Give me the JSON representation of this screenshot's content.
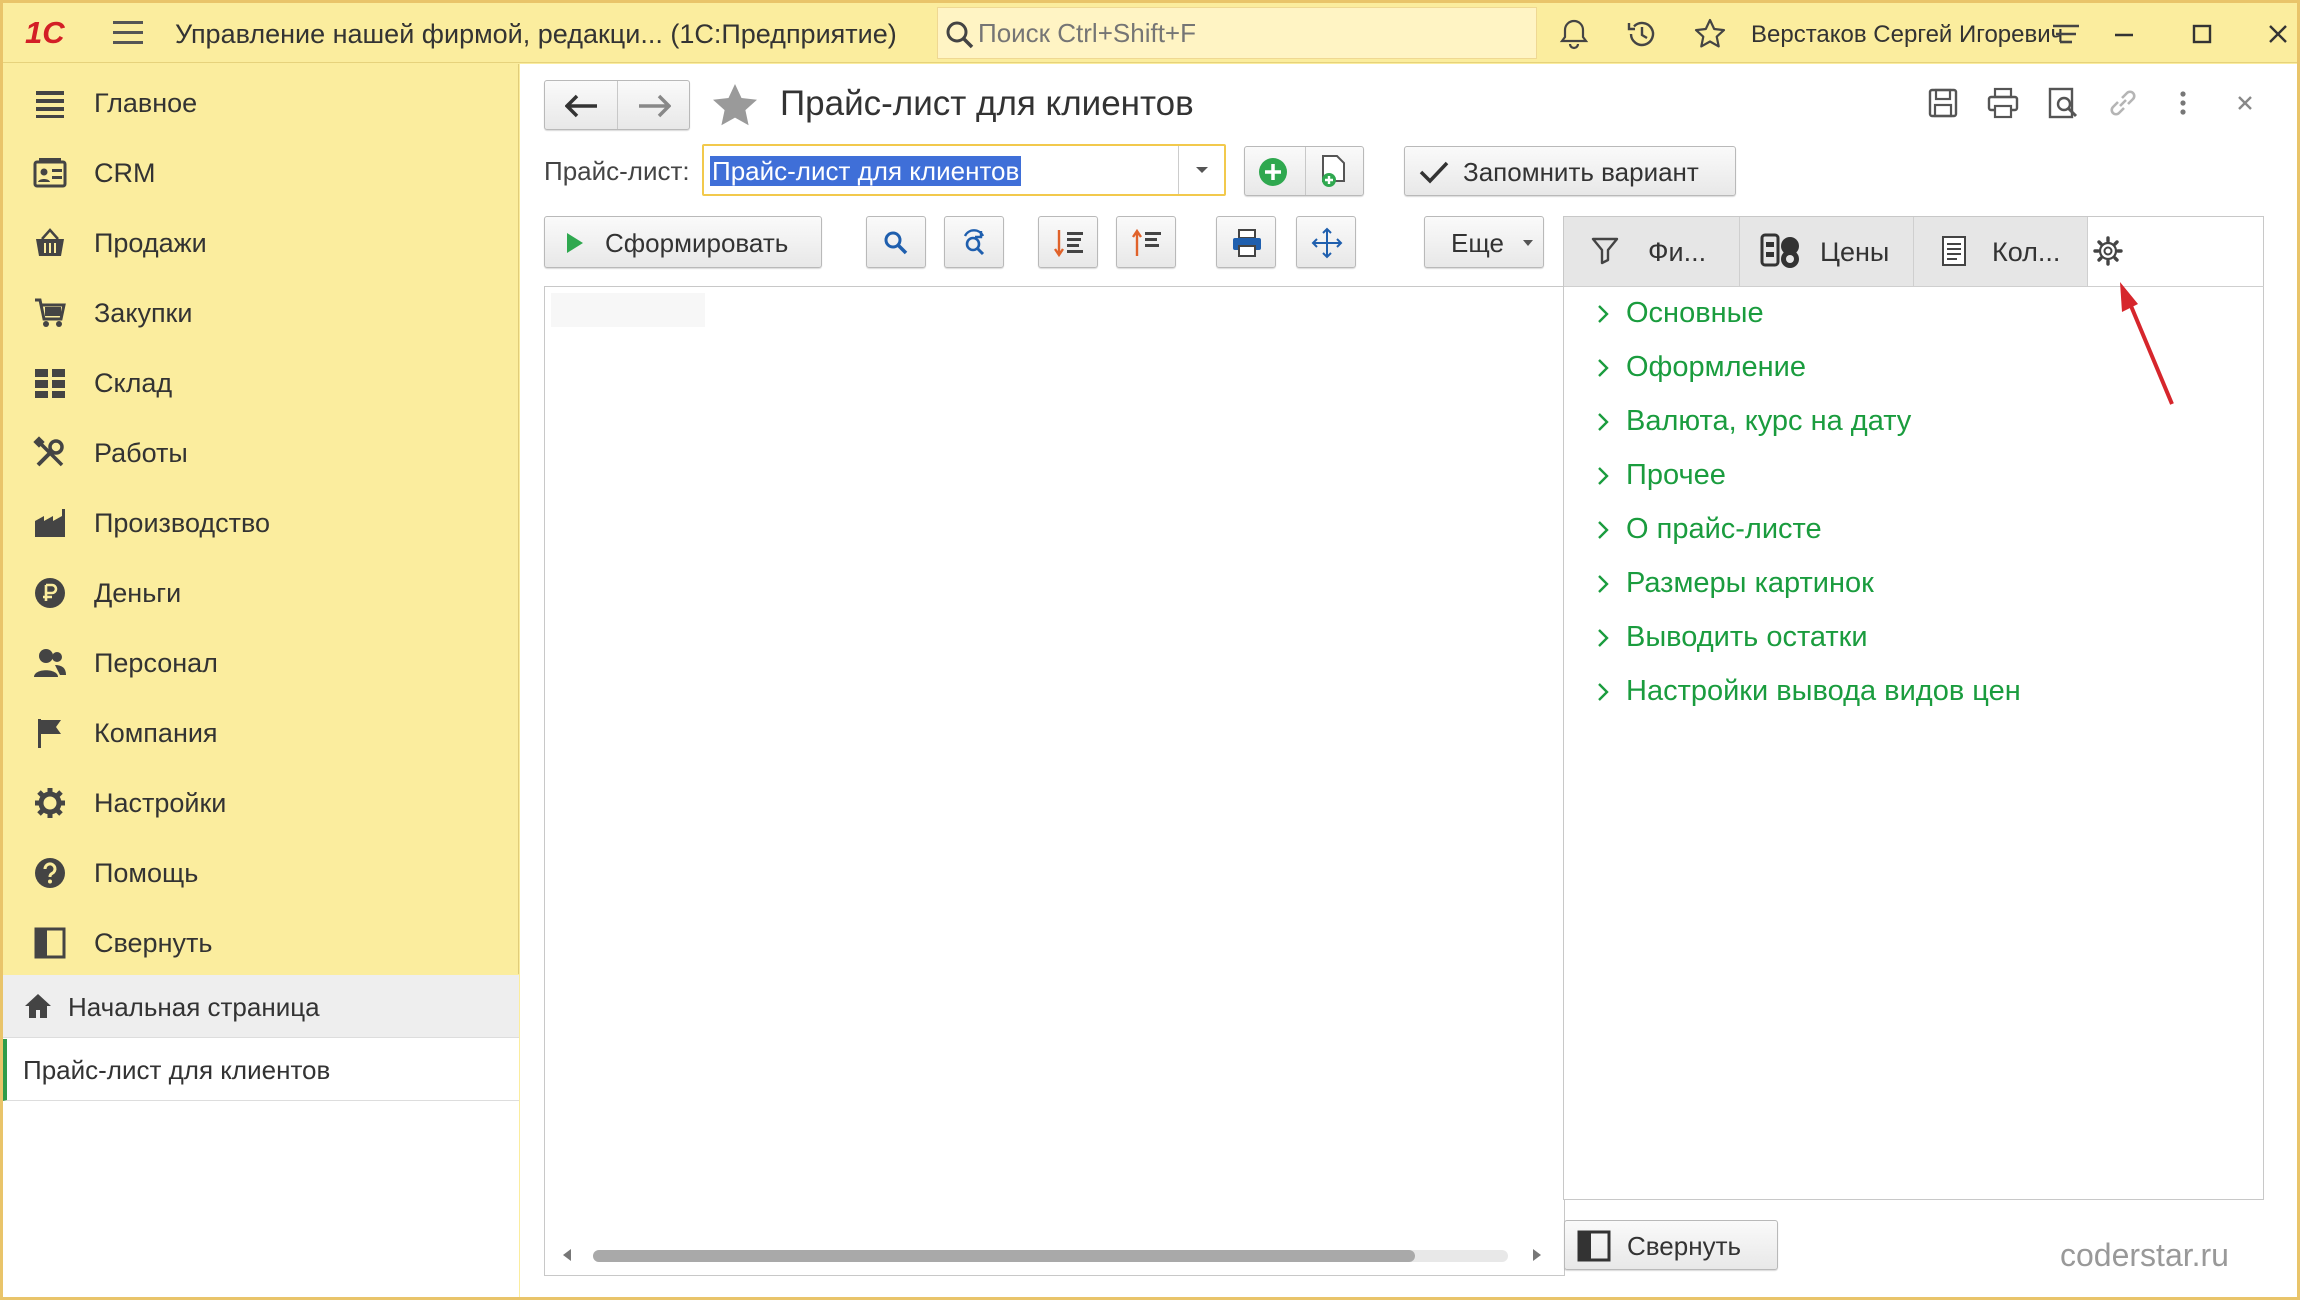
{
  "app": {
    "logo": "1С",
    "title": "Управление нашей фирмой, редакци...   (1С:Предприятие)",
    "search_placeholder": "Поиск Ctrl+Shift+F",
    "user": "Верстаков Сергей Игоревич"
  },
  "sidebar": {
    "items": [
      {
        "label": "Главное",
        "icon": "list-icon"
      },
      {
        "label": "CRM",
        "icon": "crm-card-icon"
      },
      {
        "label": "Продажи",
        "icon": "basket-icon"
      },
      {
        "label": "Закупки",
        "icon": "cart-icon"
      },
      {
        "label": "Склад",
        "icon": "warehouse-grid-icon"
      },
      {
        "label": "Работы",
        "icon": "tools-icon"
      },
      {
        "label": "Производство",
        "icon": "factory-icon"
      },
      {
        "label": "Деньги",
        "icon": "ruble-icon"
      },
      {
        "label": "Персонал",
        "icon": "people-icon"
      },
      {
        "label": "Компания",
        "icon": "flag-icon"
      },
      {
        "label": "Настройки",
        "icon": "gear-icon"
      },
      {
        "label": "Помощь",
        "icon": "question-icon"
      },
      {
        "label": "Свернуть",
        "icon": "collapse-icon"
      }
    ],
    "opened": {
      "home": "Начальная страница",
      "current": "Прайс-лист для клиентов"
    }
  },
  "form": {
    "title": "Прайс-лист для клиентов",
    "pricelist_label": "Прайс-лист:",
    "pricelist_value": "Прайс-лист для клиентов",
    "remember_label": "Запомнить вариант",
    "generate_label": "Сформировать",
    "more_label": "Еще"
  },
  "settings": {
    "tabs": [
      {
        "label": "Фи...",
        "icon": "filter-icon"
      },
      {
        "label": "Цены",
        "icon": "coins-icon"
      },
      {
        "label": "Кол...",
        "icon": "document-icon"
      }
    ],
    "groups": [
      "Основные",
      "Оформление",
      "Валюта, курс на дату",
      "Прочее",
      "О прайс-листе",
      "Размеры картинок",
      "Выводить остатки",
      "Настройки вывода видов цен"
    ],
    "collapse_label": "Свернуть"
  },
  "colors": {
    "accent_green": "#1a9c3e",
    "sidebar_bg": "#fbed9e",
    "arrow_red": "#d6262c"
  },
  "watermark": "coderstar.ru"
}
